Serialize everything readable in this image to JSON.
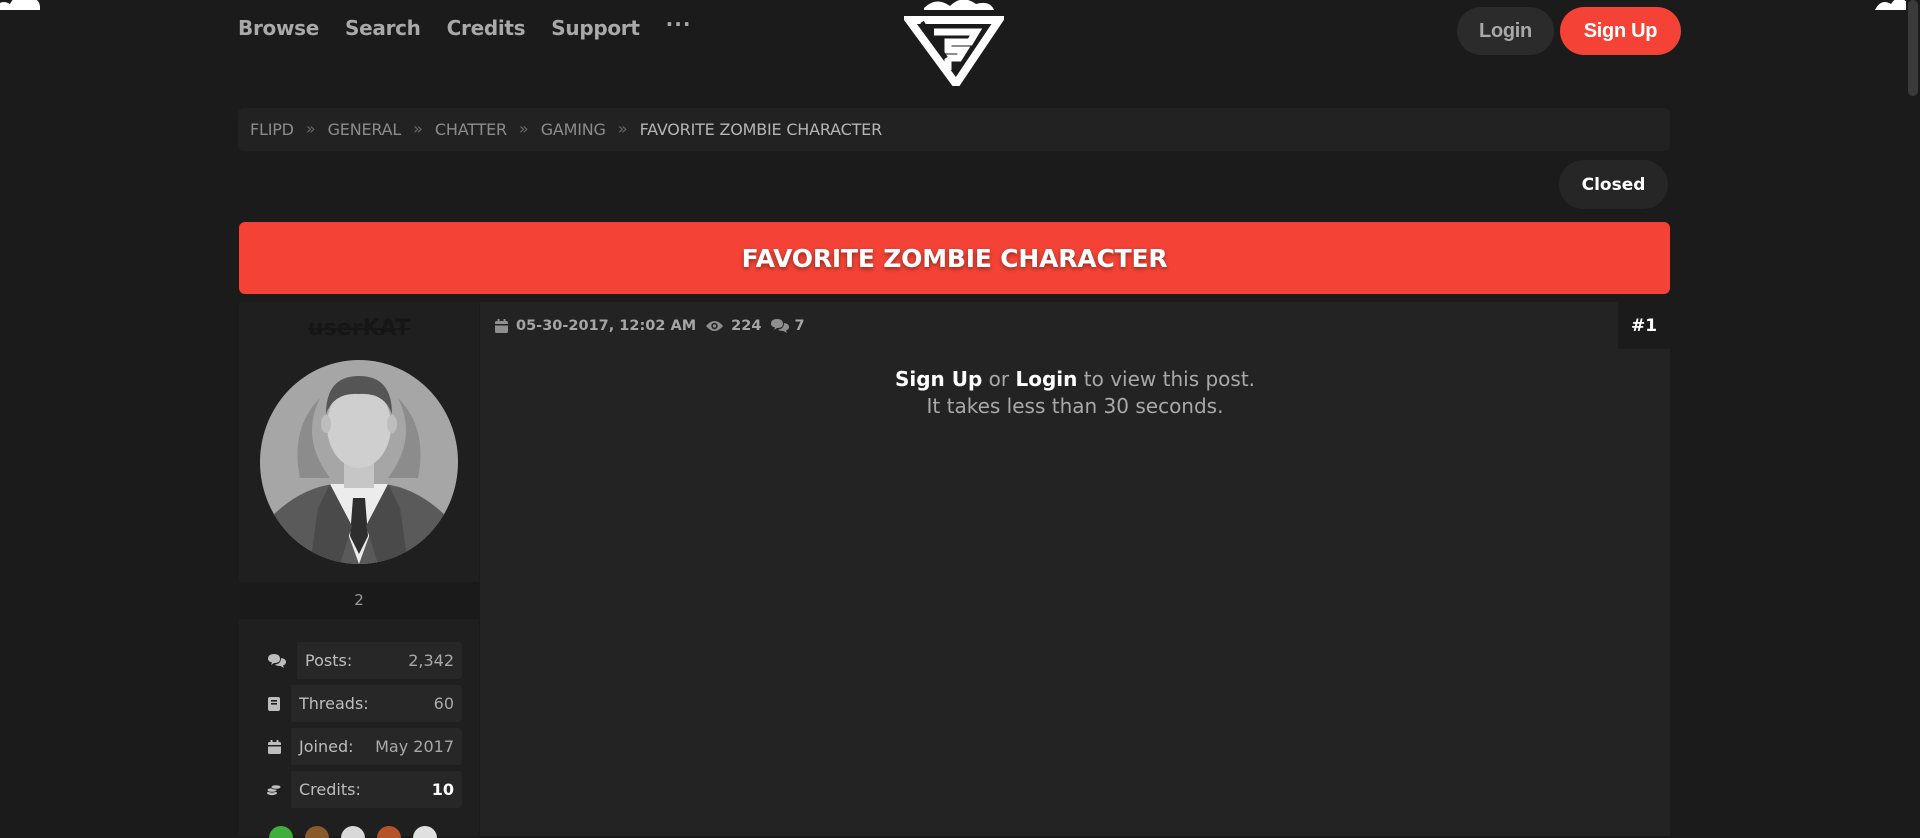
{
  "nav": {
    "items": [
      "Browse",
      "Search",
      "Credits",
      "Support"
    ],
    "more": "···"
  },
  "auth": {
    "login": "Login",
    "signup": "Sign Up"
  },
  "breadcrumb": {
    "items": [
      "FLIPD",
      "GENERAL",
      "CHATTER",
      "GAMING",
      "FAVORITE ZOMBIE CHARACTER"
    ],
    "separator": "»"
  },
  "thread": {
    "status": "Closed",
    "title": "FAVORITE ZOMBIE CHARACTER"
  },
  "author": {
    "username": "userKAT",
    "reputation": "2",
    "stats": [
      {
        "label": "Posts:",
        "value": "2,342",
        "icon": "comments-icon"
      },
      {
        "label": "Threads:",
        "value": "60",
        "icon": "book-icon"
      },
      {
        "label": "Joined:",
        "value": "May 2017",
        "icon": "calendar-icon"
      },
      {
        "label": "Credits:",
        "value": "10",
        "icon": "coins-icon"
      }
    ]
  },
  "post": {
    "date": "05-30-2017, 12:02 AM",
    "views": "224",
    "replies": "7",
    "number": "#1",
    "gate_signup": "Sign Up",
    "gate_or": "or",
    "gate_login": "Login",
    "gate_rest": "to view this post.",
    "gate_line2": "It takes less than 30 seconds."
  },
  "colors": {
    "accent": "#f44336",
    "background": "#1b1b1b",
    "panel": "#232323"
  }
}
